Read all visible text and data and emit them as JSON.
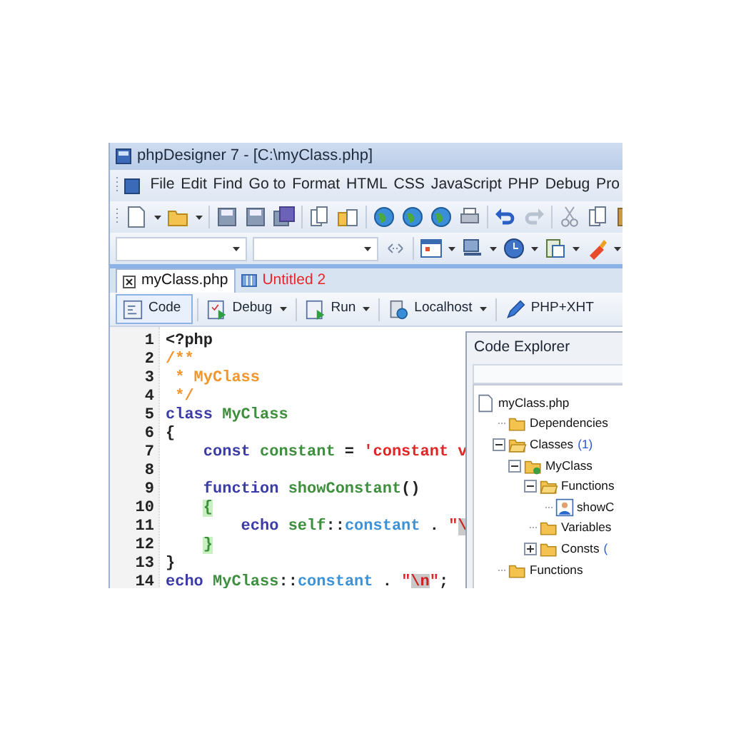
{
  "window": {
    "title": "phpDesigner 7 - [C:\\myClass.php]"
  },
  "menu": [
    "File",
    "Edit",
    "Find",
    "Go to",
    "Format",
    "HTML",
    "CSS",
    "JavaScript",
    "PHP",
    "Debug",
    "Pro"
  ],
  "tabs": [
    {
      "label": "myClass.php",
      "selected": true,
      "unsaved": false
    },
    {
      "label": "Untitled 2",
      "selected": false,
      "unsaved": true
    }
  ],
  "mode_buttons": [
    {
      "label": "Code",
      "kind": "code",
      "selected": true,
      "dropdown": false
    },
    {
      "label": "Debug",
      "kind": "debug",
      "selected": false,
      "dropdown": true
    },
    {
      "label": "Run",
      "kind": "run",
      "selected": false,
      "dropdown": true
    },
    {
      "label": "Localhost",
      "kind": "server",
      "selected": false,
      "dropdown": true
    },
    {
      "label": "PHP+XHT",
      "kind": "pencil",
      "selected": false,
      "dropdown": false
    }
  ],
  "code_lines": [
    {
      "number": "1",
      "tokens": [
        {
          "text": "<?php",
          "color": "#222222"
        }
      ]
    },
    {
      "number": "2",
      "tokens": [
        {
          "text": "/**",
          "color": "#f2952e"
        }
      ]
    },
    {
      "number": "3",
      "tokens": [
        {
          "text": " * MyClass",
          "color": "#f2952e"
        }
      ]
    },
    {
      "number": "4",
      "tokens": [
        {
          "text": " */",
          "color": "#f2952e"
        }
      ]
    },
    {
      "number": "5",
      "tokens": [
        {
          "text": "class ",
          "color": "#3b3ba8"
        },
        {
          "text": "MyClass",
          "color": "#3d8f3d"
        }
      ]
    },
    {
      "number": "6",
      "tokens": [
        {
          "text": "{",
          "color": "#222222"
        }
      ]
    },
    {
      "number": "7",
      "tokens": [
        {
          "text": "    const ",
          "color": "#3b3ba8"
        },
        {
          "text": "constant",
          "color": "#3d8f3d"
        },
        {
          "text": " = ",
          "color": "#222222"
        },
        {
          "text": "'constant v",
          "color": "#e02626"
        }
      ]
    },
    {
      "number": "8"
    },
    {
      "number": "9",
      "tokens": [
        {
          "text": "    function ",
          "color": "#3b3ba8"
        },
        {
          "text": "showConstant",
          "color": "#3d8f3d"
        },
        {
          "text": "()",
          "color": "#222222"
        }
      ]
    },
    {
      "number": "10",
      "tokens": [
        {
          "text": "    {",
          "color": "#3d8f3d",
          "kind": "match"
        }
      ]
    },
    {
      "number": "11",
      "tokens": [
        {
          "text": "        echo ",
          "color": "#3b3ba8"
        },
        {
          "text": "self",
          "color": "#3d8f3d"
        },
        {
          "text": "::",
          "color": "#222222"
        },
        {
          "text": "constant",
          "color": "#3c92d8"
        },
        {
          "text": " . ",
          "color": "#222222"
        },
        {
          "text": "\"",
          "color": "#e02626"
        },
        {
          "text": "\\",
          "color": "#d02020",
          "kind": "escape"
        }
      ]
    },
    {
      "number": "12",
      "tokens": [
        {
          "text": "    }",
          "color": "#3d8f3d",
          "kind": "match"
        }
      ]
    },
    {
      "number": "13",
      "tokens": [
        {
          "text": "}",
          "color": "#222222"
        }
      ]
    },
    {
      "number": "14",
      "tokens": [
        {
          "text": "echo ",
          "color": "#3b3ba8"
        },
        {
          "text": "MyClass",
          "color": "#3d8f3d"
        },
        {
          "text": "::",
          "color": "#222222"
        },
        {
          "text": "constant",
          "color": "#3c92d8"
        },
        {
          "text": " . ",
          "color": "#222222"
        },
        {
          "text": "\"",
          "color": "#e02626"
        },
        {
          "text": "\\n",
          "color": "#d02020",
          "kind": "escape"
        },
        {
          "text": "\"",
          "color": "#e02626"
        },
        {
          "text": ";",
          "color": "#222222"
        }
      ]
    }
  ],
  "explorer": {
    "title": "Code Explorer",
    "tree": [
      {
        "label": "myClass.php",
        "kind": "file",
        "children": [
          {
            "label": "Dependencies",
            "kind": "folder"
          },
          {
            "label": "Classes",
            "count": "(1)",
            "kind": "folder-open",
            "expanded": true,
            "children": [
              {
                "label": "MyClass",
                "kind": "class",
                "expanded": true,
                "children": [
                  {
                    "label": "Functions",
                    "kind": "folder-open",
                    "expanded": true,
                    "children": [
                      {
                        "label": "showC",
                        "kind": "method"
                      }
                    ]
                  },
                  {
                    "label": "Variables",
                    "kind": "folder"
                  },
                  {
                    "label": "Consts",
                    "count": "(",
                    "kind": "folder",
                    "expanded": false
                  }
                ]
              }
            ]
          },
          {
            "label": "Functions",
            "kind": "folder"
          }
        ]
      }
    ]
  }
}
